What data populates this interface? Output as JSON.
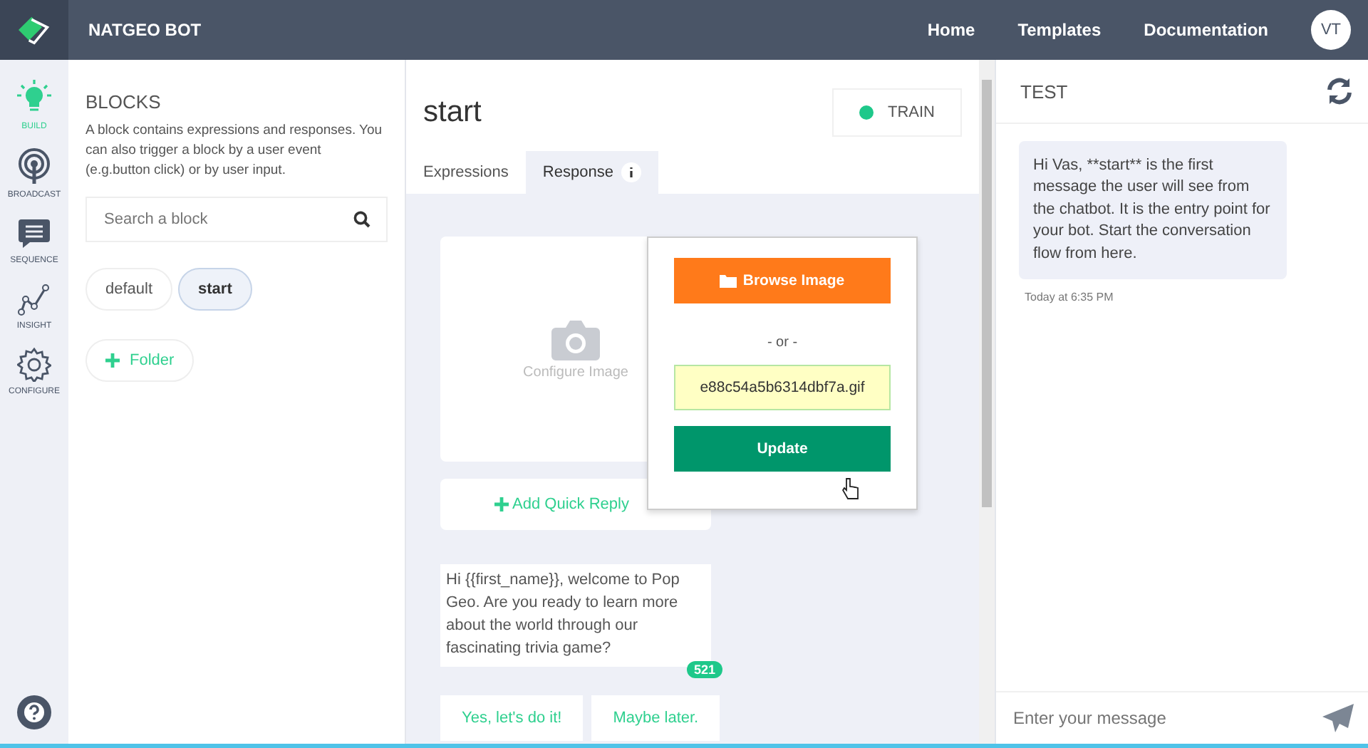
{
  "app": {
    "title": "NATGEO BOT"
  },
  "nav": [
    {
      "label": "Home"
    },
    {
      "label": "Templates"
    },
    {
      "label": "Documentation"
    }
  ],
  "user": {
    "initials": "VT"
  },
  "sidebar": [
    {
      "label": "BUILD",
      "kind": "bulb",
      "selected": true
    },
    {
      "label": "BROADCAST",
      "kind": "broadcast",
      "selected": false
    },
    {
      "label": "SEQUENCE",
      "kind": "chat",
      "selected": false
    },
    {
      "label": "INSIGHT",
      "kind": "chart",
      "selected": false
    },
    {
      "label": "CONFIGURE",
      "kind": "gear",
      "selected": false
    }
  ],
  "blocks": {
    "title": "BLOCKS",
    "description": "A block contains expressions and responses. You can also trigger a block by a user event (e.g.button click) or by user input.",
    "search": {
      "placeholder": "Search a block"
    },
    "items": [
      {
        "label": "default",
        "selected": false
      },
      {
        "label": "start",
        "selected": true
      }
    ],
    "folder_button": "Folder"
  },
  "editor": {
    "title": "start",
    "train_button": "TRAIN",
    "tabs": [
      {
        "label": "Expressions",
        "selected": false
      },
      {
        "label": "Response",
        "selected": true
      }
    ],
    "image_card": {
      "label": "Configure Image"
    },
    "popover": {
      "browse_button": "Browse Image",
      "separator": "- or -",
      "url_value": "e88c54a5b6314dbf7a.gif",
      "update_button": "Update"
    },
    "add_quick_reply": "Add Quick Reply",
    "message": {
      "text": "Hi {{first_name}}, welcome to Pop Geo. Are you ready to learn more about the world through our fascinating trivia game?",
      "count": "521"
    },
    "quick_replies": [
      "Yes, let's do it!",
      "Maybe later."
    ]
  },
  "test": {
    "title": "TEST",
    "messages": [
      {
        "text": "Hi Vas, **start** is the first message the user will see from the chatbot. It is the entry point for your bot. Start the conversation flow from here.",
        "time": "Today at 6:35 PM"
      }
    ],
    "input": {
      "placeholder": "Enter your message"
    }
  }
}
